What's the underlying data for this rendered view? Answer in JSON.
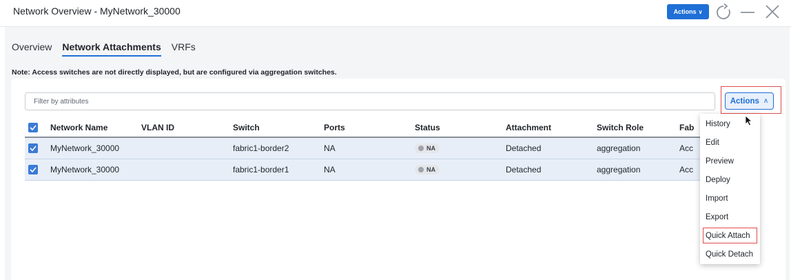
{
  "header": {
    "title": "Network Overview - MyNetwork_30000",
    "actions_label": "Actions",
    "actions_chevron": "∨"
  },
  "tabs": [
    {
      "label": "Overview",
      "active": false
    },
    {
      "label": "Network Attachments",
      "active": true
    },
    {
      "label": "VRFs",
      "active": false
    }
  ],
  "note": "Note: Access switches are not directly displayed, but are configured via aggregation switches.",
  "filter": {
    "placeholder": "Filter by attributes",
    "value": ""
  },
  "actions_button": {
    "label": "Actions",
    "chevron": "∧"
  },
  "table": {
    "columns": [
      "Network Name",
      "VLAN ID",
      "Switch",
      "Ports",
      "Status",
      "Attachment",
      "Switch Role",
      "Fab"
    ],
    "rows": [
      {
        "network_name": "MyNetwork_30000",
        "vlan_id": "",
        "switch": "fabric1-border2",
        "ports": "NA",
        "status": "NA",
        "attachment": "Detached",
        "switch_role": "aggregation",
        "fabric": "Acc"
      },
      {
        "network_name": "MyNetwork_30000",
        "vlan_id": "",
        "switch": "fabric1-border1",
        "ports": "NA",
        "status": "NA",
        "attachment": "Detached",
        "switch_role": "aggregation",
        "fabric": "Acc"
      }
    ]
  },
  "actions_menu": {
    "items": [
      "History",
      "Edit",
      "Preview",
      "Deploy",
      "Import",
      "Export",
      "Quick Attach",
      "Quick Detach"
    ],
    "highlighted": "Quick Attach"
  },
  "colors": {
    "accent": "#1f6fd6",
    "highlight_border": "#e04b4b",
    "row_selected": "#e8eef8",
    "checkbox": "#3a7bd5"
  }
}
